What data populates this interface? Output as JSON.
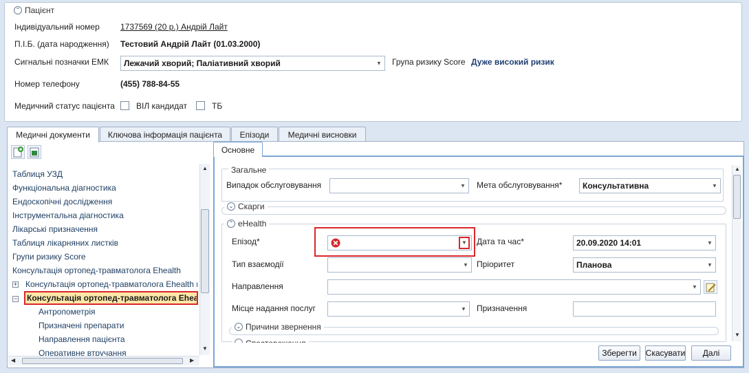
{
  "patient": {
    "legend": "Пацієнт",
    "id_label": "Індивідуальний номер",
    "id_value": "1737569 (20 р.) Андрій Лайт",
    "name_label": "П.І.Б. (дата народження)",
    "name_value": "Тестовий Андрій Лайт (01.03.2000)",
    "emk_label": "Сигнальні позначки ЕМК",
    "emk_value": "Лежачий хворий; Паліативний хворий",
    "risk_label": "Група ризику Score",
    "risk_value": "Дуже високий ризик",
    "phone_label": "Номер телефону",
    "phone_value": "(455) 788-84-55",
    "status_label": "Медичний статус пацієнта",
    "vil_label": "ВІЛ кандидат",
    "tb_label": "ТБ"
  },
  "tabs": [
    "Медичні документи",
    "Ключова інформація пацієнта",
    "Епізоди",
    "Медичні висновки"
  ],
  "tree": {
    "items": [
      "Таблиця УЗД",
      "Функціональна діагностика",
      "Ендоскопічні дослідження",
      "Інструментальна діагностика",
      "Лікарські призначення",
      "Таблиця лікарняних листків",
      "Групи ризику Score",
      "Консультація ортопед-травматолога Ehealth"
    ],
    "expand_item": "Консультація ортопед-травматолога Ehealth в",
    "selected_item": "Консультація ортопед-травматолога Eheal",
    "children": [
      "Антропометрія",
      "Призначені препарати",
      "Направлення пацієнта",
      "Оперативне втручання"
    ]
  },
  "form": {
    "tab": "Основне",
    "general_legend": "Загальне",
    "case_label": "Випадок обслуговування",
    "purpose_label": "Мета обслуговування*",
    "purpose_value": "Консультативна",
    "complaints_legend": "Скарги",
    "ehealth_legend": "eHealth",
    "episode_label": "Епізод*",
    "datetime_label": "Дата та час*",
    "datetime_value": "20.09.2020 14:01",
    "interaction_label": "Тип взаємодії",
    "priority_label": "Пріоритет",
    "priority_value": "Планова",
    "referral_label": "Направлення",
    "place_label": "Місце надання послуг",
    "assignments_label": "Призначення",
    "reasons_legend": "Причини звернення",
    "observations_legend": "Спостереження"
  },
  "buttons": {
    "save": "Зберегти",
    "cancel": "Скасувати",
    "next": "Далі"
  },
  "colors": {
    "highlight_red": "#d9262b",
    "selected_bg": "#fde7a8"
  }
}
